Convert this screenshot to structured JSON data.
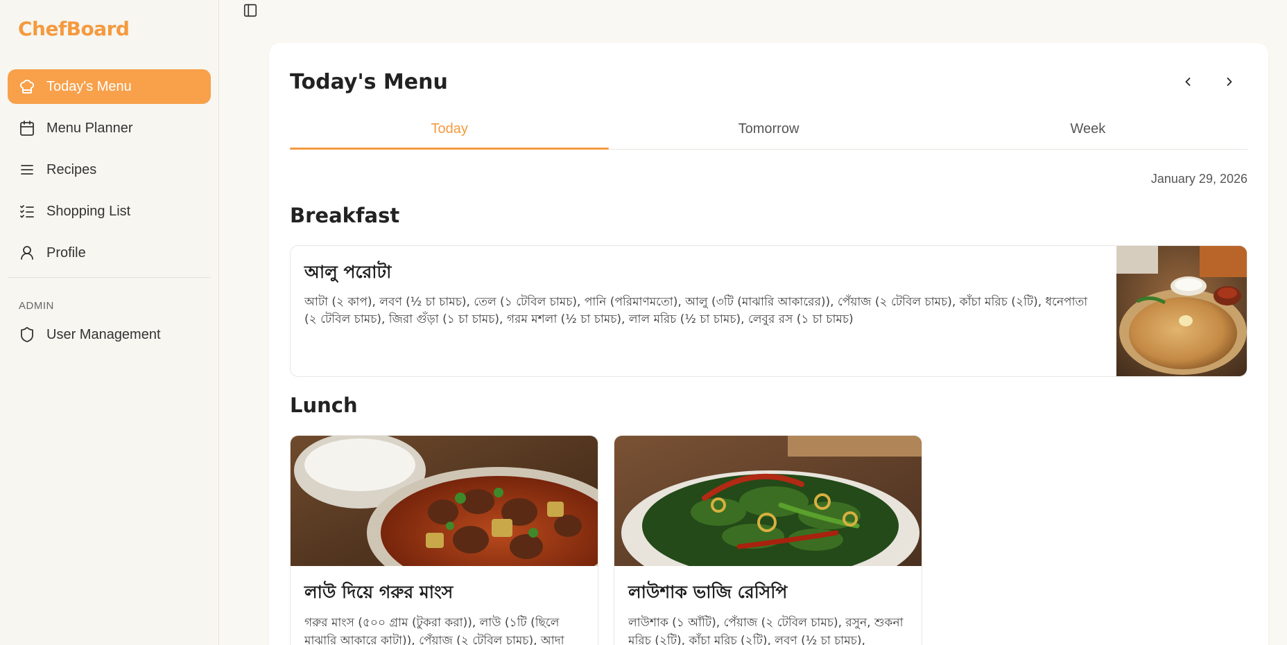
{
  "brand": "ChefBoard",
  "sidebar": {
    "items": [
      {
        "label": "Today's Menu",
        "icon": "chef-hat-icon",
        "active": true
      },
      {
        "label": "Menu Planner",
        "icon": "calendar-icon"
      },
      {
        "label": "Recipes",
        "icon": "list-icon"
      },
      {
        "label": "Shopping List",
        "icon": "checklist-icon"
      },
      {
        "label": "Profile",
        "icon": "user-icon"
      }
    ],
    "admin_label": "ADMIN",
    "admin_items": [
      {
        "label": "User Management",
        "icon": "shield-icon"
      }
    ]
  },
  "main": {
    "title": "Today's Menu",
    "tabs": [
      {
        "label": "Today",
        "active": true
      },
      {
        "label": "Tomorrow"
      },
      {
        "label": "Week"
      }
    ],
    "date": "January 29, 2026",
    "breakfast": {
      "heading": "Breakfast",
      "dish": {
        "title": "আলু পরোটা",
        "description": "আটা (২ কাপ), লবণ (½ চা চামচ), তেল (১ টেবিল চামচ), পানি (পরিমাণমতো), আলু (৩টি (মাঝারি আকারের)), পেঁয়াজ (২ টেবিল চামচ), কাঁচা মরিচ (২টি), ধনেপাতা (২ টেবিল চামচ), জিরা গুঁড়া (১ চা চামচ), গরম মশলা (½ চা চামচ), লাল মরিচ (½ চা চামচ), লেবুর রস (১ চা চামচ)"
      }
    },
    "lunch": {
      "heading": "Lunch",
      "dishes": [
        {
          "title": "লাউ দিয়ে গরুর মাংস",
          "description": "গরুর মাংস (৫০০ গ্রাম (টুকরা করা)), লাউ (১টি (ছিলে মাঝারি আকারে কাটা)), পেঁয়াজ (২ টেবিল চামচ), আদা"
        },
        {
          "title": "লাউশাক ভাজি রেসিপি",
          "description": "লাউশাক (১ আঁটি), পেঁয়াজ (২ টেবিল চামচ), রসুন, শুকনা মরিচ (২টি), কাঁচা মরিচ (২টি), লবণ (½ চা চামচ),"
        }
      ]
    }
  },
  "colors": {
    "accent": "#f49a3f",
    "active_nav_bg": "#f8a04a",
    "page_bg": "#f9f8f3"
  }
}
